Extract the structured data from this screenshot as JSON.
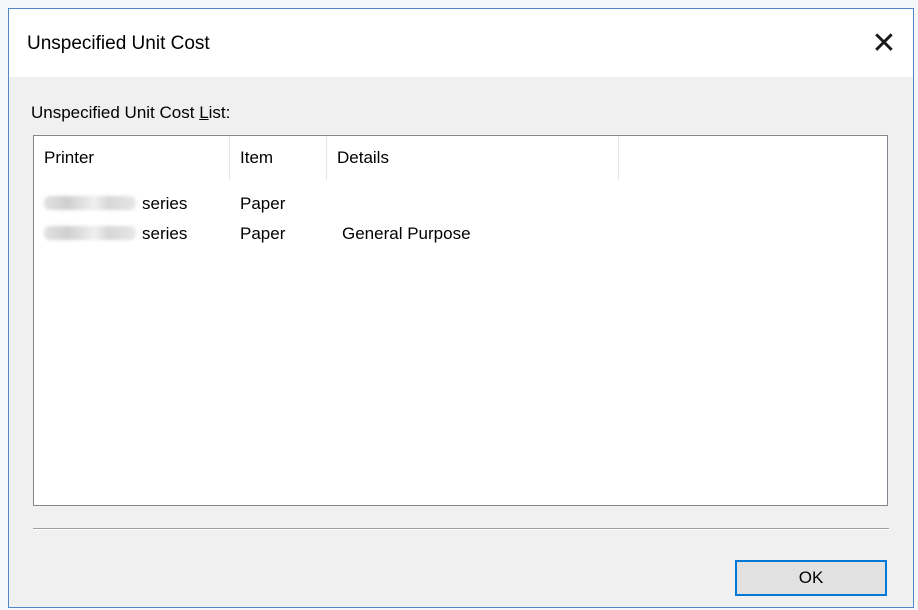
{
  "dialog": {
    "title": "Unspecified Unit Cost",
    "close_label": "✕"
  },
  "list": {
    "label_prefix": "Unspecified Unit Cost ",
    "label_accel": "L",
    "label_suffix": "ist:",
    "columns": [
      "Printer",
      "Item",
      "Details"
    ],
    "rows": [
      {
        "printer_suffix": "series",
        "item": "Paper",
        "details": ""
      },
      {
        "printer_suffix": "series",
        "item": "Paper",
        "details": "General Purpose"
      }
    ]
  },
  "buttons": {
    "ok_label": "OK"
  }
}
